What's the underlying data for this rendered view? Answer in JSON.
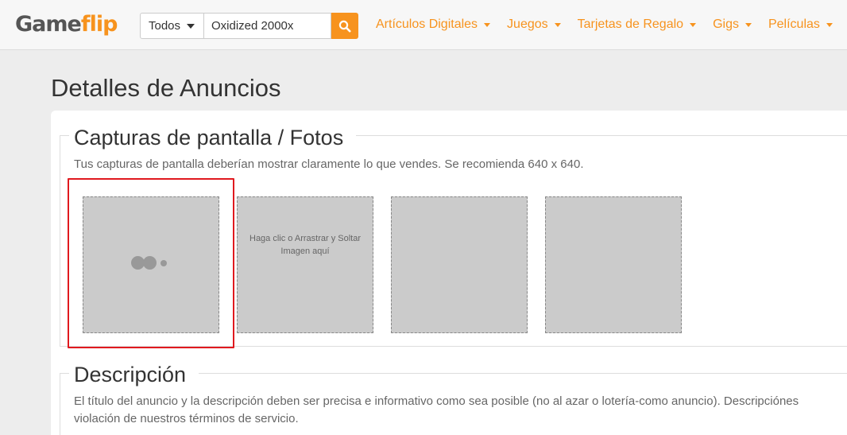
{
  "header": {
    "logo_prefix": "Game",
    "logo_accent": "flip",
    "category_select": "Todos",
    "search_value": "Oxidized 2000x",
    "nav": [
      {
        "label": "Artículos Digitales"
      },
      {
        "label": "Juegos"
      },
      {
        "label": "Tarjetas de Regalo"
      },
      {
        "label": "Gigs"
      },
      {
        "label": "Películas"
      }
    ],
    "search_icon": "search-icon"
  },
  "page": {
    "title": "Detalles de Anuncios"
  },
  "screenshots": {
    "legend": "Capturas de pantalla / Fotos",
    "help": "Tus capturas de pantalla deberían mostrar claramente lo que vendes. Se recomienda 640 x 640.",
    "dropzone_text": "Haga clic o Arrastrar y Soltar Imagen aquí"
  },
  "description": {
    "legend": "Descripción",
    "help_line1": "El título del anuncio y la descripción deben ser precisa e informativo como sea posible (no al azar o lotería-como anuncio). Descripciónes",
    "help_line2": "violación de nuestros términos de servicio."
  },
  "colors": {
    "brand": "#f7931e",
    "highlight": "#e0191f"
  }
}
